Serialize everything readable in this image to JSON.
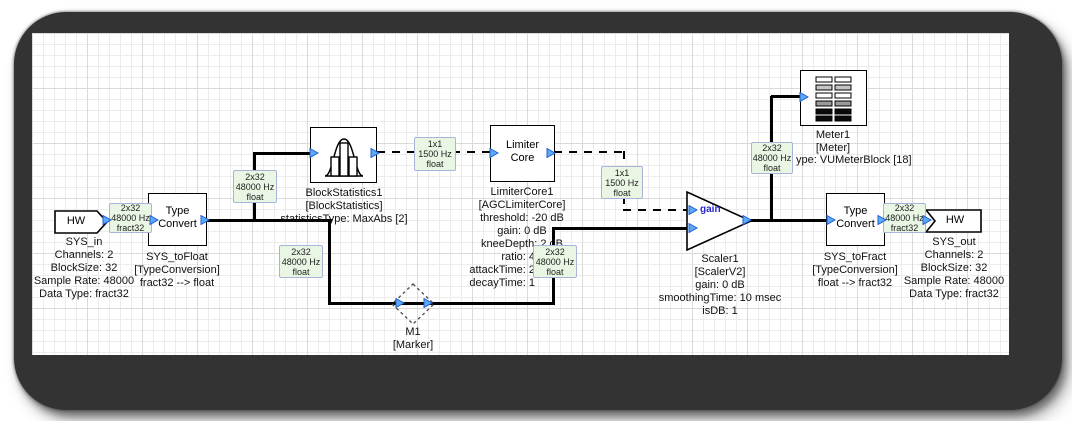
{
  "colors": {
    "wire": "#000000",
    "pin_fill": "#5da9f7",
    "pin_stroke": "#1e5ecf",
    "wire_label_bg": "#eaf6e4",
    "wire_label_border": "#aab4d8",
    "gain_text": "#2626cc",
    "frame": "#333333",
    "grid_minor": "#ececec",
    "grid_major": "#dadada"
  },
  "blocks": {
    "sys_in": {
      "title": "HW",
      "caption": [
        "SYS_in",
        "Channels: 2",
        "BlockSize: 32",
        "Sample Rate: 48000",
        "Data Type: fract32"
      ]
    },
    "type_convert_in": {
      "title_lines": [
        "Type",
        "Convert"
      ],
      "caption": [
        "SYS_toFloat",
        "[TypeConversion]",
        "fract32 --> float"
      ]
    },
    "block_statistics": {
      "icon": "histogram-icon",
      "caption": [
        "BlockStatistics1",
        "[BlockStatistics]",
        "statisticsType: MaxAbs [2]"
      ]
    },
    "limiter_core": {
      "title_lines": [
        "Limiter",
        "Core"
      ],
      "caption": [
        "LimiterCore1",
        "[AGCLimiterCore]",
        "threshold: -20 dB",
        "gain: 0 dB",
        "kneeDepth: 2 dB"
      ],
      "caption_cut": [
        "ratio: 4",
        "attackTime: 2",
        "decayTime: 1"
      ]
    },
    "marker": {
      "caption": [
        "M1",
        "[Marker]"
      ]
    },
    "scaler": {
      "input_label": "gain",
      "caption": [
        "Scaler1",
        "[ScalerV2]",
        "gain: 0 dB",
        "smoothingTime: 10 msec",
        "isDB: 1"
      ]
    },
    "meter": {
      "icon": "vu-meter-icon",
      "caption": [
        "Meter1",
        "[Meter]"
      ],
      "caption_cut": "ype: VUMeterBlock [18]"
    },
    "type_convert_out": {
      "title_lines": [
        "Type",
        "Convert"
      ],
      "caption": [
        "SYS_toFract",
        "[TypeConversion]",
        "float --> fract32"
      ]
    },
    "sys_out": {
      "title": "HW",
      "caption": [
        "SYS_out",
        "Channels: 2",
        "BlockSize: 32",
        "Sample Rate: 48000",
        "Data Type: fract32"
      ]
    }
  },
  "wire_labels": {
    "l1": {
      "lines": [
        "2x32",
        "48000 Hz",
        "fract32"
      ]
    },
    "l2": {
      "lines": [
        "2x32",
        "48000 Hz",
        "float"
      ]
    },
    "l3": {
      "lines": [
        "2x32",
        "48000 Hz",
        "float"
      ]
    },
    "l4": {
      "lines": [
        "1x1",
        "1500 Hz",
        "float"
      ]
    },
    "l5": {
      "lines": [
        "1x1",
        "1500 Hz",
        "float"
      ]
    },
    "l6": {
      "lines": [
        "2x32",
        "48000 Hz",
        "float"
      ]
    },
    "l7": {
      "lines": [
        "2x32",
        "48000 Hz",
        "float"
      ]
    },
    "l8": {
      "lines": [
        "2x32",
        "48000 Hz",
        "fract32"
      ]
    }
  }
}
